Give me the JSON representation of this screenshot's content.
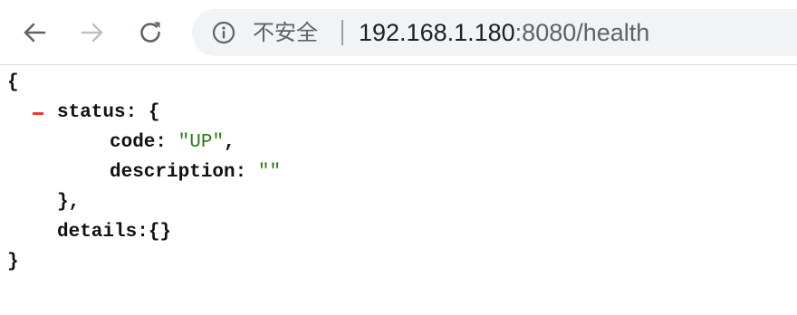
{
  "browser": {
    "security_label": "不安全",
    "url_host": "192.168.1.180",
    "url_rest": ":8080/health"
  },
  "json_view": {
    "open_brace": "{",
    "status_key": "status",
    "status_open": ": {",
    "code_key": "code",
    "code_value": "\"UP\"",
    "description_key": "description",
    "description_value": "\"\"",
    "status_close": "},",
    "details_key": "details",
    "details_value": ":{}",
    "close_brace": "}"
  }
}
